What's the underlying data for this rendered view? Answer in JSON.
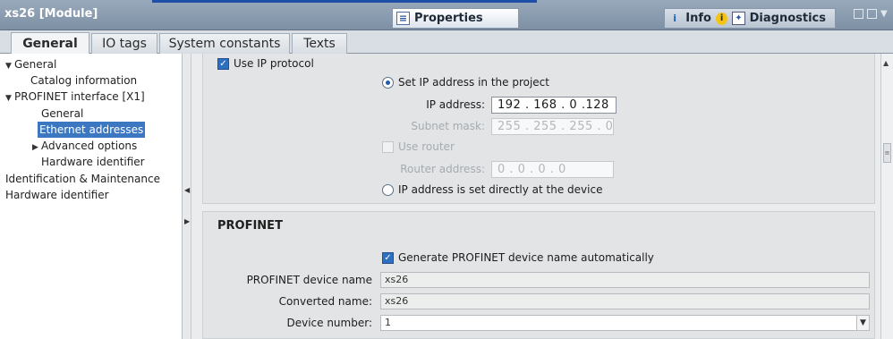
{
  "window": {
    "title": "xs26 [Module]",
    "tabs": {
      "properties": "Properties",
      "info": "Info",
      "diagnostics": "Diagnostics"
    }
  },
  "subtabs": [
    "General",
    "IO tags",
    "System constants",
    "Texts"
  ],
  "nav": {
    "items": [
      {
        "label": "General",
        "expand": "open"
      },
      {
        "label": "Catalog information",
        "expand": ""
      },
      {
        "label": "PROFINET interface [X1]",
        "expand": "open"
      },
      {
        "label": "General",
        "expand": ""
      },
      {
        "label": "Ethernet addresses",
        "expand": "",
        "selected": true
      },
      {
        "label": "Advanced options",
        "expand": "closed"
      },
      {
        "label": "Hardware identifier",
        "expand": ""
      },
      {
        "label": "Identification & Maintenance",
        "expand": ""
      },
      {
        "label": "Hardware identifier",
        "expand": ""
      }
    ]
  },
  "ip_protocol": {
    "use_ip_label": "Use IP protocol",
    "set_ip_label": "Set IP address in the project",
    "ip_address_label": "IP address:",
    "ip_address_value": "192 . 168 . 0    .128",
    "subnet_label": "Subnet mask:",
    "subnet_value": "255 . 255 . 255 . 0",
    "use_router_label": "Use router",
    "router_label": "Router address:",
    "router_value": "0    . 0     . 0     . 0",
    "set_directly_label": "IP address is set directly at the device"
  },
  "profinet": {
    "heading": "PROFINET",
    "auto_name_label": "Generate PROFINET device name automatically",
    "device_name_label": "PROFINET device name",
    "device_name_value": "xs26",
    "converted_label": "Converted name:",
    "converted_value": "xs26",
    "device_number_label": "Device number:",
    "device_number_value": "1"
  },
  "colors": {
    "selection": "#3c77c2",
    "title_bar": "#8597ab",
    "checkbox_checked": "#2f6fc0"
  }
}
